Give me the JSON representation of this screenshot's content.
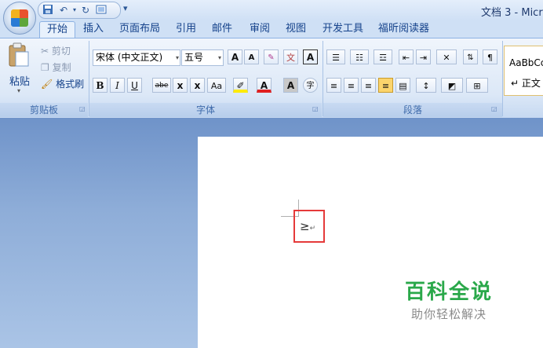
{
  "window": {
    "title": "文档 3 - Micr"
  },
  "quick_access": {
    "save_icon": "save-icon",
    "undo": "↶",
    "undo_arrow": "▾",
    "redo": "↻",
    "custom": "▾"
  },
  "tabs": [
    "开始",
    "插入",
    "页面布局",
    "引用",
    "邮件",
    "审阅",
    "视图",
    "开发工具",
    "福昕阅读器"
  ],
  "clipboard": {
    "paste": "粘贴",
    "cut": "剪切",
    "copy": "复制",
    "format_painter": "格式刷",
    "group": "剪贴板"
  },
  "font": {
    "name": "宋体 (中文正文)",
    "size": "五号",
    "group": "字体",
    "grow": "A",
    "shrink": "A",
    "bold": "B",
    "italic": "I",
    "underline": "U",
    "strike": "abe",
    "subscript": "x",
    "superscript": "x",
    "case": "Aa",
    "font_color": "A",
    "char_shade": "A",
    "enclose": "字",
    "phonetic": "文"
  },
  "paragraph": {
    "group": "段落"
  },
  "styles": {
    "preview": "AaBbCc",
    "name": "↵ 正文"
  },
  "document": {
    "content": "≥",
    "mark": "↵"
  },
  "watermark": {
    "title": "百科全说",
    "subtitle": "助你轻松解决"
  },
  "colors": {
    "highlight_border": "#e53a3a",
    "watermark_green": "#2aa84a"
  }
}
